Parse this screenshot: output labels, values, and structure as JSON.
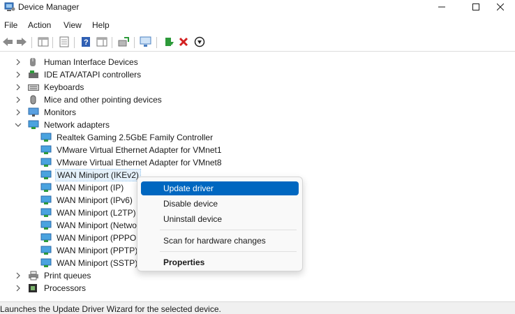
{
  "window": {
    "title": "Device Manager",
    "app_icon": "device-manager-icon",
    "controls": {
      "minimize": "minimize-icon",
      "maximize": "maximize-icon",
      "close": "close-icon"
    }
  },
  "menu": [
    "File",
    "Action",
    "View",
    "Help"
  ],
  "toolbar": {
    "icons": [
      "back-icon",
      "forward-icon",
      "show-hide-console-tree-icon",
      "properties-icon",
      "help-icon",
      "show-action-pane-icon",
      "update-driver-icon",
      "scan-hardware-icon",
      "enable-device-icon",
      "uninstall-icon",
      "disable-device-icon"
    ]
  },
  "tree": {
    "categories_top": [
      {
        "label": "Human Interface Devices",
        "icon": "hid-icon"
      },
      {
        "label": "IDE ATA/ATAPI controllers",
        "icon": "ide-controller-icon"
      },
      {
        "label": "Keyboards",
        "icon": "keyboard-icon"
      },
      {
        "label": "Mice and other pointing devices",
        "icon": "mouse-icon"
      },
      {
        "label": "Monitors",
        "icon": "monitor-icon"
      }
    ],
    "network": {
      "label": "Network adapters",
      "icon": "network-adapter-icon",
      "expanded": true,
      "children": [
        "Realtek Gaming 2.5GbE Family Controller",
        "VMware Virtual Ethernet Adapter for VMnet1",
        "VMware Virtual Ethernet Adapter for VMnet8",
        "WAN Miniport (IKEv2)",
        "WAN Miniport (IP)",
        "WAN Miniport (IPv6)",
        "WAN Miniport (L2TP)",
        "WAN Miniport (Netwo",
        "WAN Miniport (PPPOI",
        "WAN Miniport (PPTP)",
        "WAN Miniport (SSTP)"
      ],
      "selected_child": "WAN Miniport (IKEv2)"
    },
    "categories_bottom": [
      {
        "label": "Print queues",
        "icon": "printer-icon"
      },
      {
        "label": "Processors",
        "icon": "processor-icon"
      }
    ]
  },
  "context_menu": {
    "items": [
      {
        "label": "Update driver",
        "highlighted": true
      },
      {
        "label": "Disable device"
      },
      {
        "label": "Uninstall device"
      },
      {
        "label": "Scan for hardware changes"
      },
      {
        "label": "Properties",
        "bold": true
      }
    ]
  },
  "status": {
    "text": "Launches the Update Driver Wizard for the selected device."
  },
  "colors": {
    "menu_highlight": "#0067c0",
    "selection_bg": "#e5f1fb",
    "uninstall_red": "#d32020"
  }
}
